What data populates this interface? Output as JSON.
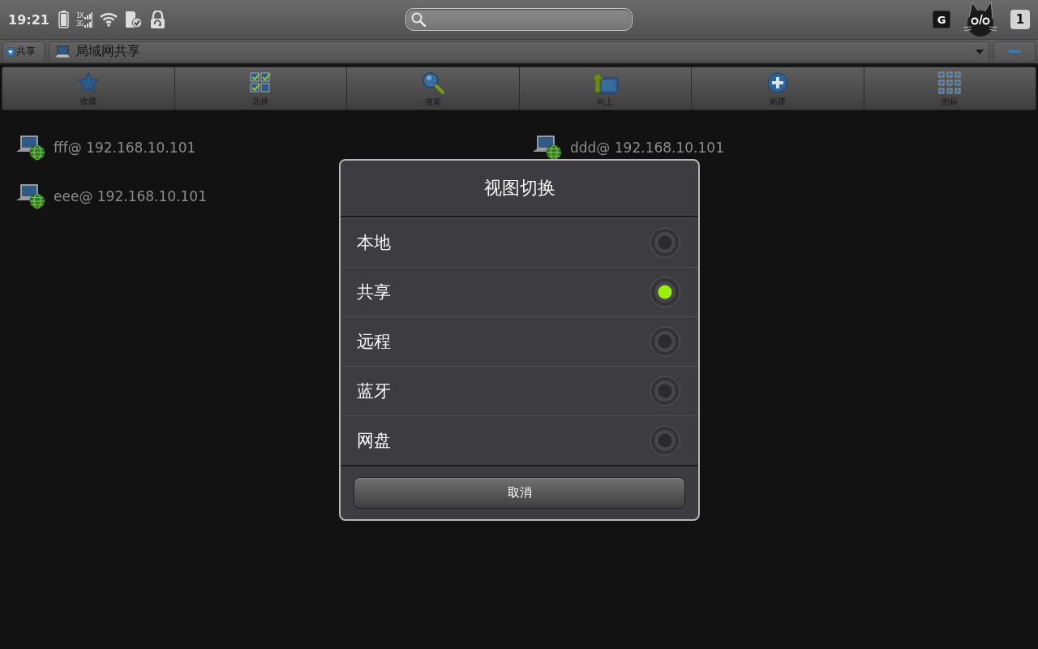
{
  "status_bar": {
    "time": "19:21",
    "network_labels": [
      "1X",
      "3G"
    ],
    "badge_letter": "G",
    "notification_count": "1"
  },
  "location_bar": {
    "mode_button": "共享",
    "path": "局域网共享"
  },
  "toolbar": [
    {
      "kind": "favorite",
      "label": "收藏"
    },
    {
      "kind": "select",
      "label": "选择"
    },
    {
      "kind": "search",
      "label": "搜索"
    },
    {
      "kind": "up",
      "label": "向上"
    },
    {
      "kind": "new",
      "label": "新建"
    },
    {
      "kind": "view",
      "label": "图标"
    }
  ],
  "hosts": [
    "fff@ 192.168.10.101",
    "ddd@ 192.168.10.101",
    "eee@ 192.168.10.101"
  ],
  "dialog": {
    "title": "视图切换",
    "options": [
      {
        "label": "本地",
        "selected": false
      },
      {
        "label": "共享",
        "selected": true
      },
      {
        "label": "远程",
        "selected": false
      },
      {
        "label": "蓝牙",
        "selected": false
      },
      {
        "label": "网盘",
        "selected": false
      }
    ],
    "cancel_button": "取消"
  }
}
